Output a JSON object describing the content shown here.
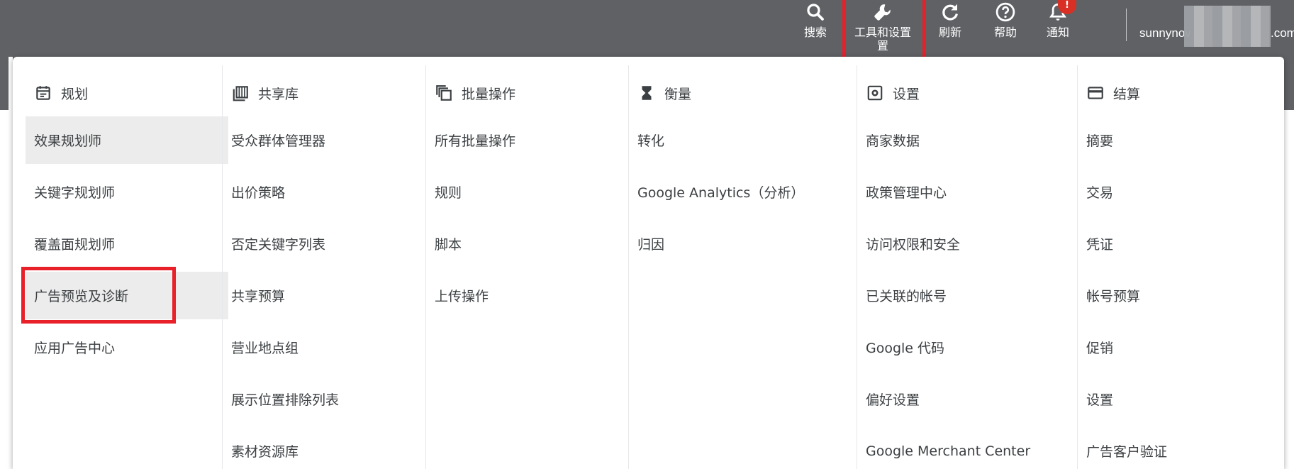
{
  "topbar": {
    "search_label": "搜索",
    "tools_label": "工具和设置",
    "tools_label_line2": "置",
    "refresh_label": "刷新",
    "help_label": "帮助",
    "notify_label": "通知",
    "notify_badge": "!",
    "account_visible": "sunnynov",
    "account_suffix": ".com"
  },
  "colors": {
    "topbar_bg": "#5f6165",
    "panel_bg": "#ffffff",
    "active_item_bg": "#ececec",
    "highlight": "#e8202a",
    "badge": "#d93025"
  },
  "columns": [
    {
      "header": "规划",
      "icon": "calendar-icon",
      "items": [
        "效果规划师",
        "关键字规划师",
        "覆盖面规划师",
        "广告预览及诊断",
        "应用广告中心"
      ]
    },
    {
      "header": "共享库",
      "icon": "library-icon",
      "items": [
        "受众群体管理器",
        "出价策略",
        "否定关键字列表",
        "共享预算",
        "营业地点组",
        "展示位置排除列表",
        "素材资源库"
      ]
    },
    {
      "header": "批量操作",
      "icon": "bulk-actions-icon",
      "items": [
        "所有批量操作",
        "规则",
        "脚本",
        "上传操作"
      ]
    },
    {
      "header": "衡量",
      "icon": "hourglass-icon",
      "items": [
        "转化",
        "Google Analytics（分析）",
        "归因"
      ]
    },
    {
      "header": "设置",
      "icon": "settings-icon",
      "items": [
        "商家数据",
        "政策管理中心",
        "访问权限和安全",
        "已关联的帐号",
        "Google 代码",
        "偏好设置",
        "Google Merchant Center"
      ]
    },
    {
      "header": "结算",
      "icon": "credit-card-icon",
      "items": [
        "摘要",
        "交易",
        "凭证",
        "帐号预算",
        "促销",
        "设置",
        "广告客户验证"
      ]
    }
  ]
}
